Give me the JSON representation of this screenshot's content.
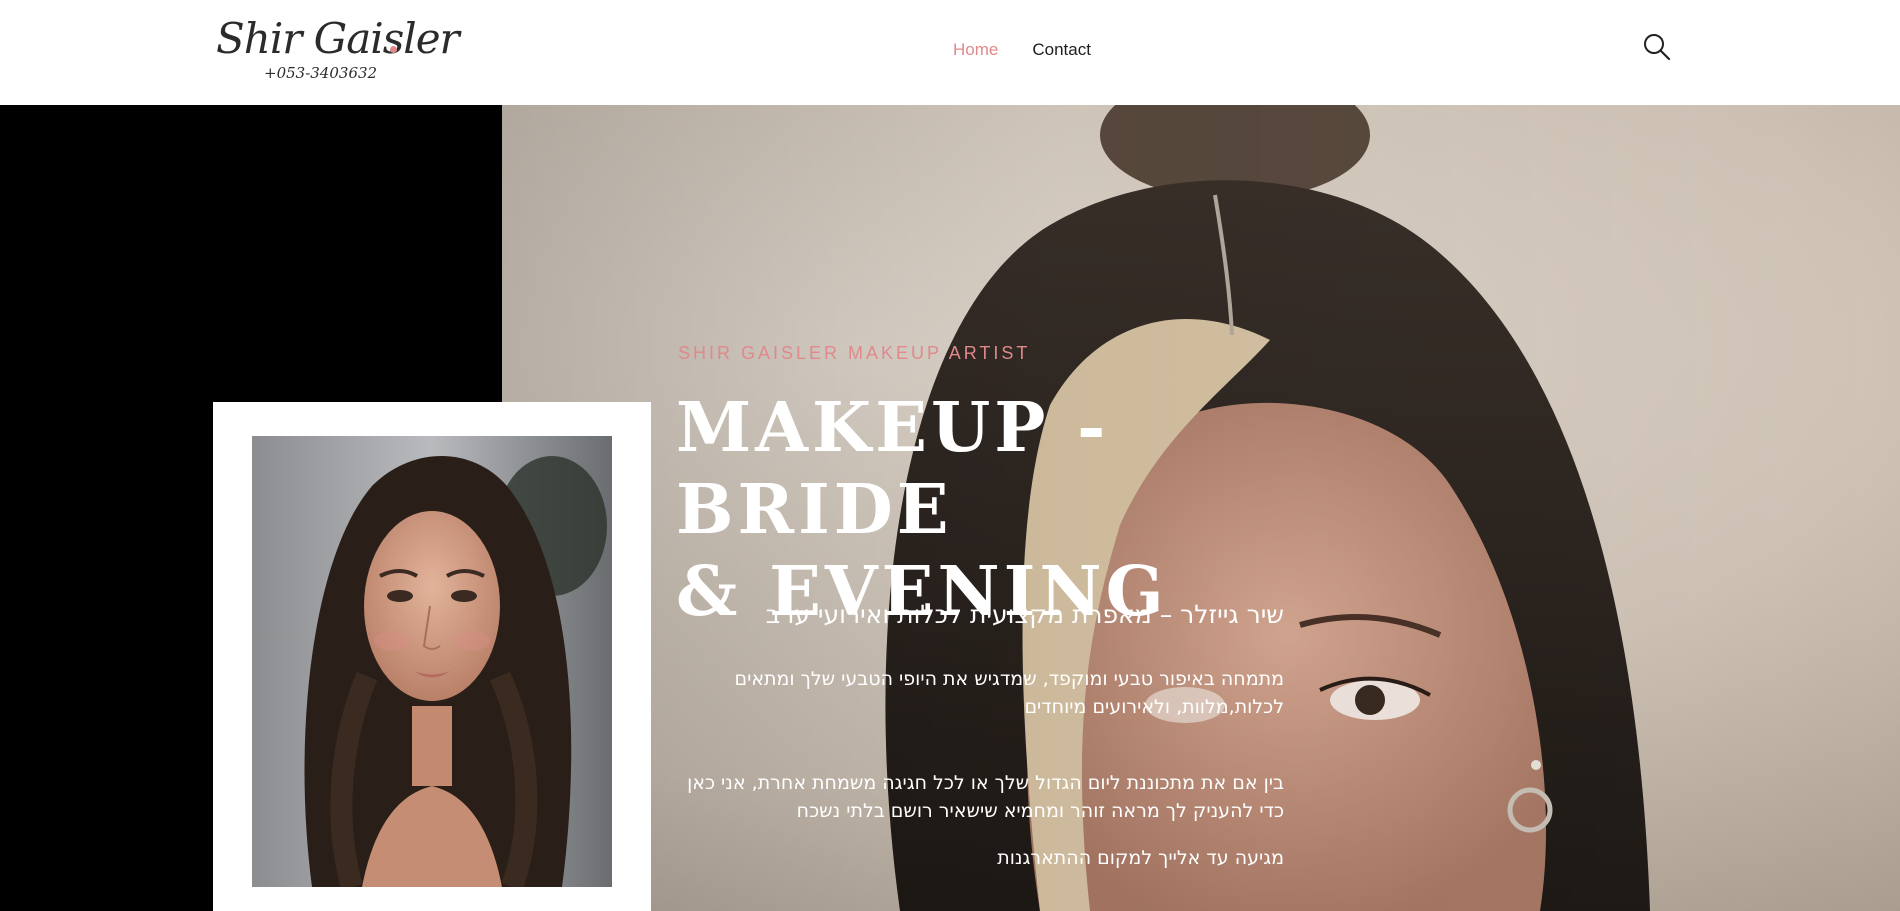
{
  "header": {
    "logo": {
      "name": "Shir Gaisler",
      "phone": "+053-3403632"
    },
    "nav": [
      {
        "label": "Home",
        "active": true
      },
      {
        "label": "Contact",
        "active": false
      }
    ],
    "search_icon": "search-icon"
  },
  "hero": {
    "eyebrow": "SHIR GAISLER MAKEUP ARTIST",
    "title_line1": "MAKEUP - BRIDE",
    "title_line2": "& EVENING",
    "subheading": "שיר גייזלר – מאפרת מקצועית לכלות ואירועי ערב",
    "paragraph1": "מתמחה באיפור טבעי ומוקפד, שמדגיש את היופי הטבעי שלך ומתאים לכלות,מלוות, ולאירועים מיוחדים",
    "paragraph2": "בין אם את מתכוננת ליום הגדול שלך או לכל חגיגה משמחת אחרת, אני כאן כדי להעניק לך מראה זוהר ומחמיא שישאיר רושם בלתי נשכח",
    "paragraph3": "מגיעה עד אלייך למקום ההתארגנות"
  },
  "colors": {
    "accent": "#e0898b",
    "text_dark": "#1e1e1e",
    "hero_text": "#ffffff"
  }
}
